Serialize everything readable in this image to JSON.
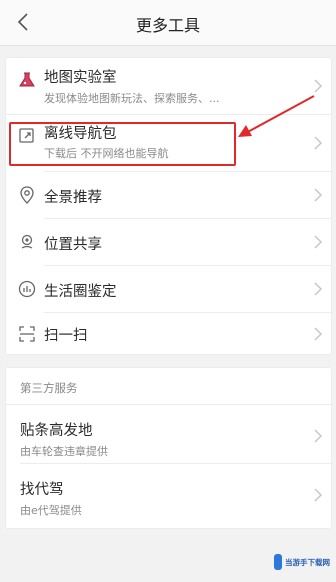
{
  "header": {
    "title": "更多工具"
  },
  "tools": [
    {
      "label": "地图实验室",
      "sub": "发现体验地图新玩法、探索服务、..."
    },
    {
      "label": "离线导航包",
      "sub": "下载后  不开网络也能导航"
    },
    {
      "label": "全景推荐"
    },
    {
      "label": "位置共享"
    },
    {
      "label": "生活圈鉴定"
    },
    {
      "label": "扫一扫"
    }
  ],
  "third_party": {
    "title": "第三方服务",
    "items": [
      {
        "label": "贴条高发地",
        "sub": "由车轮查违章提供"
      },
      {
        "label": "找代驾",
        "sub": "由e代驾提供"
      }
    ]
  },
  "watermark": {
    "text": "当游手下载网"
  },
  "colors": {
    "accent": "#e02a2a",
    "background": "#f2f2f2"
  }
}
